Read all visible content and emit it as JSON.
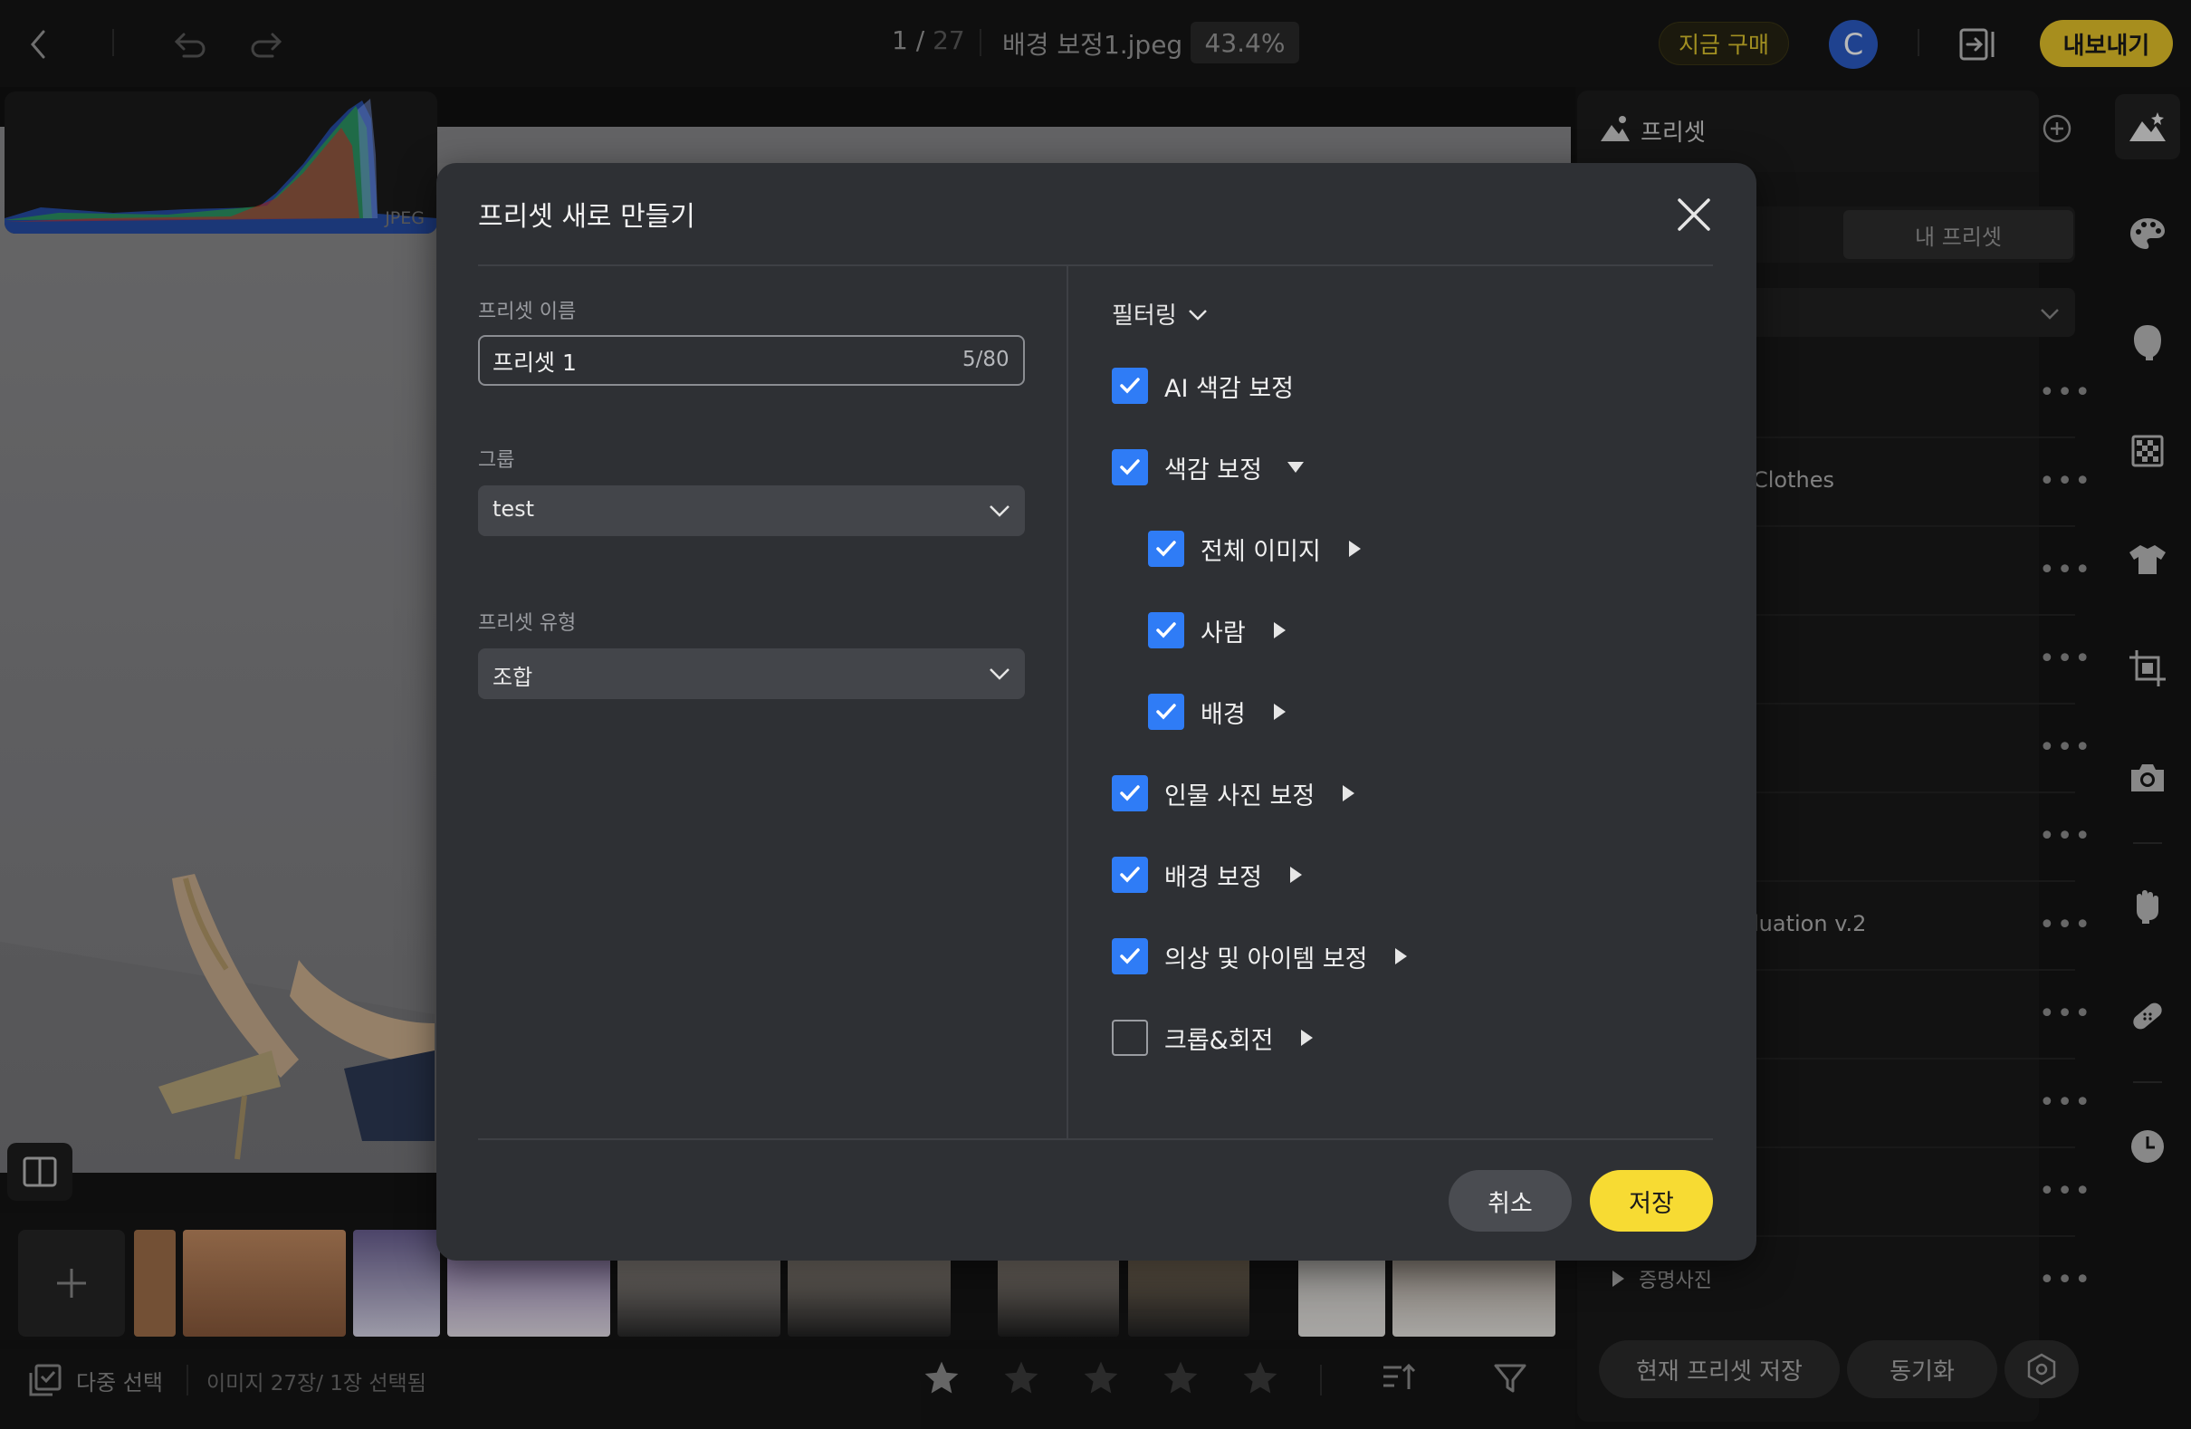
{
  "topbar": {
    "page_current": "1",
    "page_separator": " / ",
    "page_total": "27",
    "filename": "배경 보정1.jpeg",
    "zoom": "43.4%",
    "buy_label": "지금 구매",
    "avatar_letter": "C",
    "export_label": "내보내기",
    "icons": [
      "back-icon",
      "undo-icon",
      "redo-icon",
      "panel-toggle-icon"
    ]
  },
  "histogram": {
    "format_label": "JPEG"
  },
  "bottombar": {
    "multi_select_label": "다중 선택",
    "image_count": "이미지 27장/ 1장 선택됨",
    "rating_stars": 5
  },
  "preset_panel": {
    "title": "프리셋",
    "tab_mine": "내 프리셋",
    "rows": [
      {
        "label": ""
      },
      {
        "label": "Clothes"
      },
      {
        "label": ""
      },
      {
        "label": ""
      },
      {
        "label": ""
      },
      {
        "label": ""
      },
      {
        "label": "luation v.2"
      },
      {
        "label": ""
      },
      {
        "label": ""
      },
      {
        "label": ""
      }
    ],
    "folder_label": "증명사진",
    "save_current_label": "현재 프리셋 저장",
    "sync_label": "동기화"
  },
  "tools": [
    "preset-icon",
    "palette-icon",
    "face-icon",
    "background-icon",
    "clothes-icon",
    "crop-icon",
    "camera-icon",
    "hand-icon",
    "bandage-icon",
    "history-icon"
  ],
  "dialog": {
    "title": "프리셋 새로 만들기",
    "name_label": "프리셋 이름",
    "name_value": "프리셋 1",
    "name_count": "5/80",
    "group_label": "그룹",
    "group_value": "test",
    "type_label": "프리셋 유형",
    "type_value": "조합",
    "filter_label": "필터링",
    "options": [
      {
        "label": "AI 색감 보정",
        "checked": true,
        "indent": 0,
        "arrow": "none"
      },
      {
        "label": "색감 보정",
        "checked": true,
        "indent": 0,
        "arrow": "down"
      },
      {
        "label": "전체 이미지",
        "checked": true,
        "indent": 1,
        "arrow": "right"
      },
      {
        "label": "사람",
        "checked": true,
        "indent": 1,
        "arrow": "right"
      },
      {
        "label": "배경",
        "checked": true,
        "indent": 1,
        "arrow": "right"
      },
      {
        "label": "인물 사진 보정",
        "checked": true,
        "indent": 0,
        "arrow": "right"
      },
      {
        "label": "배경 보정",
        "checked": true,
        "indent": 0,
        "arrow": "right"
      },
      {
        "label": "의상 및 아이템 보정",
        "checked": true,
        "indent": 0,
        "arrow": "right"
      },
      {
        "label": "크롭&회전",
        "checked": false,
        "indent": 0,
        "arrow": "right"
      }
    ],
    "cancel_label": "취소",
    "save_label": "저장"
  }
}
